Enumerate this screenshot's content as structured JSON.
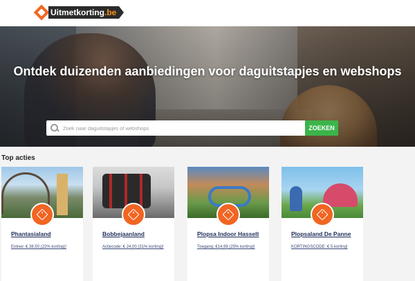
{
  "header": {
    "logo_name": "Uitmetkorting",
    "logo_tld": ".be"
  },
  "hero": {
    "title": "Ontdek duizenden aanbiedingen voor daguitstapjes en webshops",
    "search_placeholder": "Zoek naar daguitstapjes of webshops",
    "search_button": "ZOEKEN"
  },
  "section": {
    "title": "Top acties"
  },
  "cards": [
    {
      "name": "Phantasialand",
      "deal": "Entree: € 38,50 (22% korting)!"
    },
    {
      "name": "Bobbejaanland",
      "deal": "Actiecode: € 24,00 (31% korting)!"
    },
    {
      "name": "Plopsa Indoor Hasselt",
      "deal": "Toegang: €14,99 (25% korting)!"
    },
    {
      "name": "Plopsaland De Panne",
      "deal": "KORTINGSCODE: € 5 korting!"
    }
  ],
  "colors": {
    "accent": "#f26522",
    "search_button": "#3bb54a",
    "link": "#1f2d5a"
  },
  "icons": {
    "search": "magnifier-icon",
    "badge": "price-tag-icon"
  }
}
